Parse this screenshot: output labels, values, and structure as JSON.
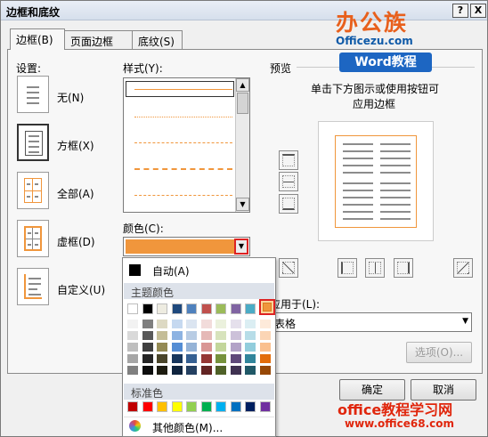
{
  "window": {
    "title": "边框和底纹",
    "help_label": "?",
    "close_label": "X"
  },
  "tabs": [
    {
      "label": "边框(B)",
      "active": true
    },
    {
      "label": "页面边框(P)",
      "active": false
    },
    {
      "label": "底纹(S)",
      "active": false
    }
  ],
  "settings": {
    "heading": "设置:",
    "options": [
      {
        "label": "无(N)",
        "selected": false
      },
      {
        "label": "方框(X)",
        "selected": true
      },
      {
        "label": "全部(A)",
        "selected": false
      },
      {
        "label": "虚框(D)",
        "selected": false
      },
      {
        "label": "自定义(U)",
        "selected": false
      }
    ]
  },
  "style": {
    "heading": "样式(Y):"
  },
  "color": {
    "heading": "颜色(C):",
    "selected_hex": "#f0963c",
    "dropdown_arrow": "▼"
  },
  "color_popup": {
    "auto_label": "自动(A)",
    "theme_heading": "主题颜色",
    "theme_top": [
      "#ffffff",
      "#000000",
      "#eeece1",
      "#1f497d",
      "#4f81bd",
      "#c0504d",
      "#9bbb59",
      "#8064a2",
      "#4bacc6",
      "#f79646"
    ],
    "theme_columns": [
      [
        "#f2f2f2",
        "#d9d9d9",
        "#bfbfbf",
        "#a6a6a6",
        "#808080"
      ],
      [
        "#7f7f7f",
        "#595959",
        "#404040",
        "#262626",
        "#0d0d0d"
      ],
      [
        "#ddd9c3",
        "#c4bd97",
        "#948a54",
        "#4a452a",
        "#1d1b10"
      ],
      [
        "#c6d9f0",
        "#8db3e2",
        "#548dd4",
        "#17365d",
        "#0f243e"
      ],
      [
        "#dbe5f1",
        "#b8cce4",
        "#95b3d7",
        "#366092",
        "#244061"
      ],
      [
        "#f2dcdb",
        "#e5b9b7",
        "#d99694",
        "#953734",
        "#632423"
      ],
      [
        "#ebf1dd",
        "#d7e3bc",
        "#c3d69b",
        "#76923c",
        "#4f6128"
      ],
      [
        "#e5e0ec",
        "#ccc1d9",
        "#b2a2c7",
        "#5f497a",
        "#3f3151"
      ],
      [
        "#dbeef3",
        "#b7dde8",
        "#92cddc",
        "#31859b",
        "#205867"
      ],
      [
        "#fdeada",
        "#fbd5b5",
        "#fac08f",
        "#e36c09",
        "#974806"
      ]
    ],
    "standard_heading": "标准色",
    "standard_colors": [
      "#c00000",
      "#ff0000",
      "#ffc000",
      "#ffff00",
      "#92d050",
      "#00b050",
      "#00b0f0",
      "#0070c0",
      "#002060",
      "#7030a0"
    ],
    "more_label": "其他颜色(M)..."
  },
  "preview": {
    "heading": "预览",
    "hint_line1": "单击下方图示或使用按钮可",
    "hint_line2": "应用边框"
  },
  "apply_to": {
    "label": "应用于(L):",
    "value": "表格"
  },
  "buttons": {
    "options": "选项(O)...",
    "ok": "确定",
    "cancel": "取消"
  },
  "watermark": {
    "brand": "办公族",
    "brand_url": "Officezu.com",
    "word_tag": "Word教程",
    "site_name": "office教程学习网",
    "site_url": "www.office68.com"
  }
}
